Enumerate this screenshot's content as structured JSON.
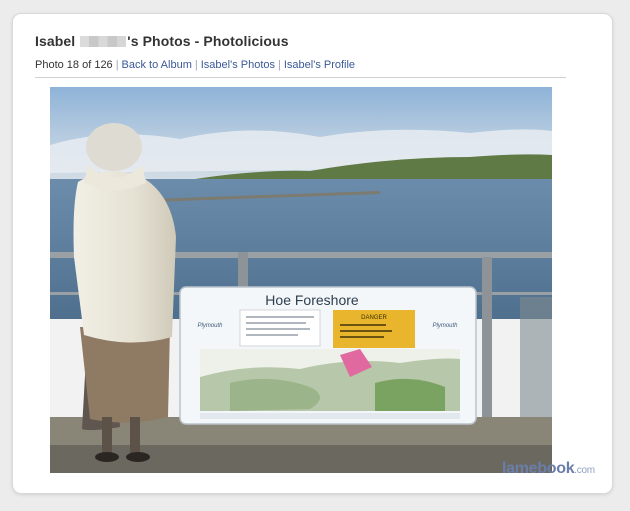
{
  "header": {
    "title_prefix": "Isabel",
    "title_suffix": "'s Photos - Photolicious"
  },
  "meta": {
    "counter": "Photo 18 of 126",
    "links": {
      "back": "Back to Album",
      "photos": "Isabel's Photos",
      "profile": "Isabel's Profile"
    }
  },
  "photo": {
    "sign": {
      "title": "Hoe Foreshore",
      "danger_label": "DANGER",
      "city_left": "Plymouth",
      "city_right": "Plymouth"
    }
  },
  "watermark": {
    "brand": "lamebook",
    "domain": ".com"
  }
}
